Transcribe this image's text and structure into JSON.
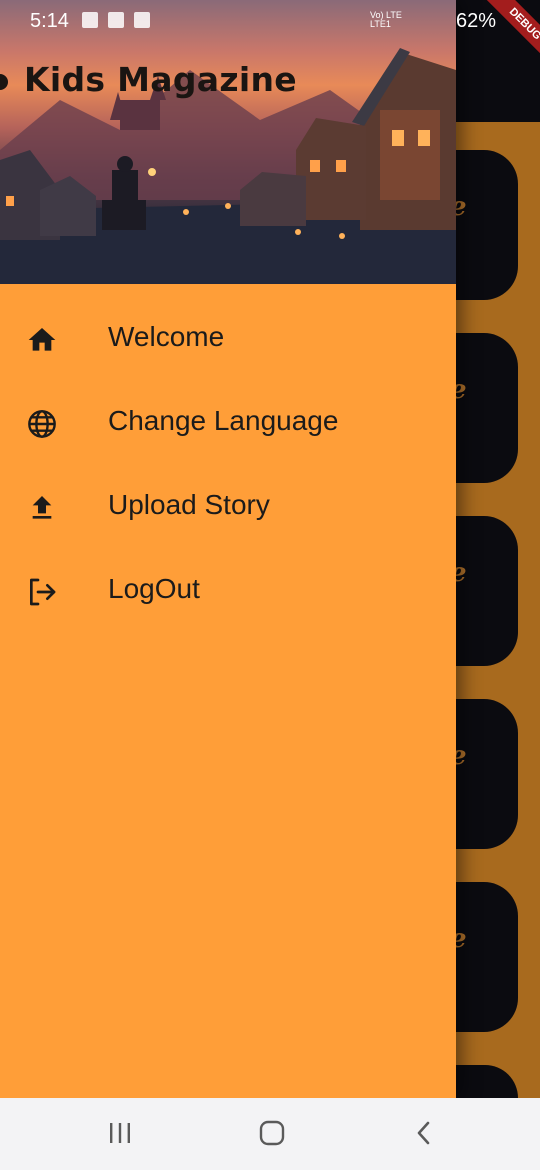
{
  "status_bar": {
    "time": "5:14",
    "network": "Vo) LTE\nLTE1",
    "battery": "62%",
    "debug_banner": "DEBUG"
  },
  "drawer": {
    "header_title": "Kids Magazine",
    "menu_items": [
      {
        "label": "Welcome",
        "icon": "home-icon"
      },
      {
        "label": "Change Language",
        "icon": "globe-icon"
      },
      {
        "label": "Upload Story",
        "icon": "upload-icon"
      },
      {
        "label": "LogOut",
        "icon": "logout-icon"
      }
    ]
  },
  "background_app": {
    "card_glyph": "e"
  },
  "navigation_bar": {
    "buttons": [
      "recent-apps-icon",
      "home-button-icon",
      "back-icon"
    ]
  },
  "colors": {
    "drawer_background": "#ff9e38",
    "app_bar": "#0b0b10",
    "text": "#1b1b1b"
  }
}
